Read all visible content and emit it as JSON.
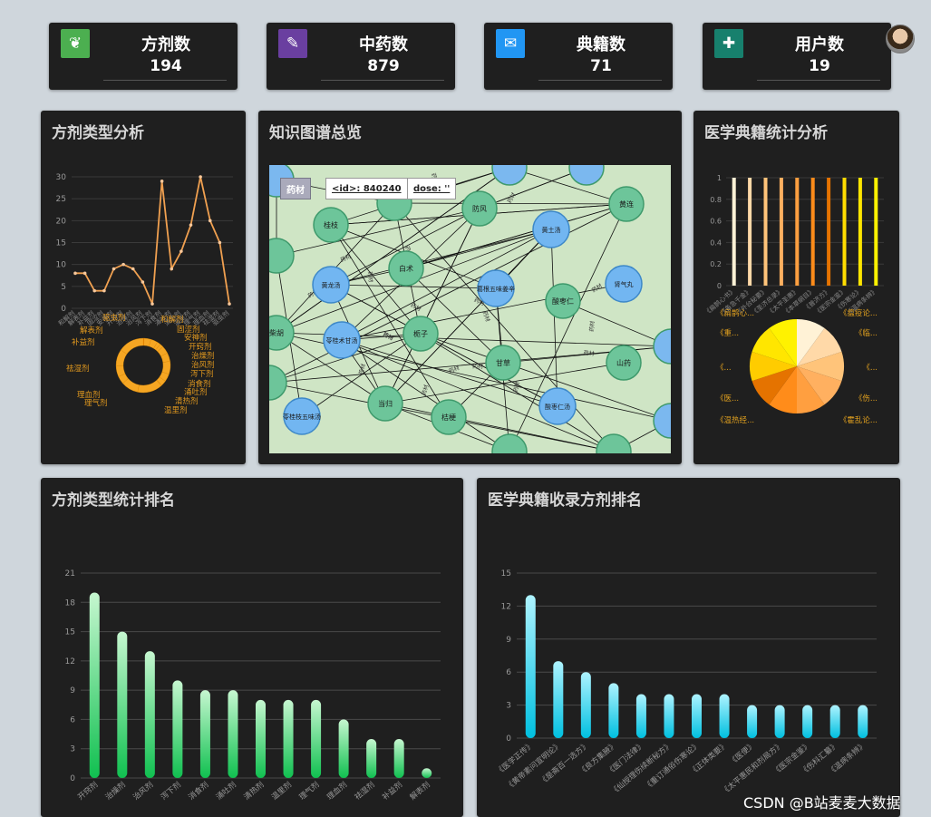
{
  "stats": [
    {
      "label": "方剂数",
      "value": "194",
      "color": "#4caf50",
      "icon": "leaf-icon",
      "glyph": "❦"
    },
    {
      "label": "中药数",
      "value": "879",
      "color": "#6a3fa0",
      "icon": "edit-icon",
      "glyph": "✎"
    },
    {
      "label": "典籍数",
      "value": "71",
      "color": "#2196f3",
      "icon": "chat-icon",
      "glyph": "✉"
    },
    {
      "label": "用户数",
      "value": "19",
      "color": "#17806d",
      "icon": "users-icon",
      "glyph": "✚"
    }
  ],
  "panels": {
    "type_analysis": "方剂类型分析",
    "kg_overview": "知识图谱总览",
    "classic_stats": "医学典籍统计分析",
    "type_rank": "方剂类型统计排名",
    "classic_rank": "医学典籍收录方剂排名"
  },
  "kg": {
    "tip_type": "药材",
    "tip_id": "<id>: 840240",
    "tip_dose": "dose: ''",
    "herb_nodes": [
      "桂枝",
      "白术",
      "栀子",
      "防风",
      "黄连",
      "酸枣仁",
      "当归",
      "柴胡",
      "山药",
      "甘草",
      "桔梗"
    ],
    "formula_nodes": [
      "黄龙汤",
      "苓桂术甘汤",
      "黄土汤",
      "肾气丸",
      "葛根五味姜辛",
      "酸枣仁汤",
      "苓桂枝五味汤"
    ],
    "edge_label": "药材"
  },
  "watermark": "CSDN @B站麦麦大数据",
  "chart_data": [
    {
      "type": "line",
      "title": "方剂类型分析",
      "categories": [
        "和解剂",
        "解表剂",
        "补益剂",
        "固涩剂",
        "安神剂",
        "开窍剂",
        "治燥剂",
        "治风剂",
        "泻下剂",
        "消食剂",
        "涌吐剂",
        "清热剂",
        "温里剂",
        "理气剂",
        "理血剂",
        "祛湿剂",
        "驱虫剂"
      ],
      "values": [
        8,
        8,
        4,
        4,
        9,
        10,
        9,
        6,
        1,
        29,
        9,
        13,
        19,
        30,
        20,
        15,
        1
      ],
      "ylim": [
        0,
        30
      ],
      "yticks": [
        0,
        5,
        10,
        15,
        20,
        25,
        30
      ],
      "color": "#f0a050"
    },
    {
      "type": "pie",
      "title": "方剂类型分析 (环形)",
      "labels": [
        "驱虫剂",
        "和解剂",
        "解表剂",
        "固涩剂",
        "补益剂",
        "安神剂",
        "开窍剂",
        "祛湿剂",
        "治燥剂",
        "治风剂",
        "泻下剂",
        "消食剂",
        "理血剂",
        "涌吐剂",
        "理气剂",
        "清热剂",
        "温里剂"
      ],
      "values": [
        1,
        8,
        8,
        4,
        4,
        9,
        10,
        15,
        9,
        6,
        1,
        29,
        20,
        9,
        13,
        19,
        30
      ],
      "color": "#f5a623"
    },
    {
      "type": "bar",
      "title": "医学典籍统计分析",
      "categories": [
        "《扁鹊心书》",
        "《备急千金》",
        "《外台秘要》",
        "《圣济总录》",
        "《太平圣惠》",
        "《本草纲目》",
        "《普济方》",
        "《医宗金鉴》",
        "《伤寒论》",
        "《温病条辨》"
      ],
      "values": [
        1,
        1,
        1,
        1,
        1,
        1,
        1,
        1,
        1,
        1
      ],
      "ylim": [
        0,
        1
      ],
      "yticks": [
        0,
        0.2,
        0.4,
        0.6,
        0.8,
        1
      ],
      "colors": [
        "#fff2d6",
        "#ffd9a8",
        "#ffc47a",
        "#ffb060",
        "#ff9f40",
        "#ff8c1a",
        "#e57300",
        "#ffdd00",
        "#ffe600",
        "#fff200"
      ]
    },
    {
      "type": "pie",
      "title": "医学典籍饼图",
      "labels": [
        "《扁鹊心...",
        "《重...",
        "《...",
        "《医...",
        "《温热经...",
        "《瘟疫论...",
        "《临...",
        "《...",
        "《伤...",
        "《霍乱论..."
      ],
      "values": [
        1,
        1,
        1,
        1,
        1,
        1,
        1,
        1,
        1,
        1
      ],
      "colors": [
        "#fff2d6",
        "#ffd9a8",
        "#ffc47a",
        "#ffb060",
        "#ff9f40",
        "#ff8c1a",
        "#e57300",
        "#ffcc00",
        "#ffe600",
        "#fff200"
      ]
    },
    {
      "type": "bar",
      "title": "方剂类型统计排名",
      "categories": [
        "开窍剂",
        "治燥剂",
        "治风剂",
        "泻下剂",
        "消食剂",
        "涌吐剂",
        "清热剂",
        "温里剂",
        "理气剂",
        "理血剂",
        "祛湿剂",
        "补益剂",
        "解表剂"
      ],
      "values": [
        19,
        15,
        13,
        10,
        9,
        9,
        8,
        8,
        8,
        6,
        4,
        4,
        1
      ],
      "ylim": [
        0,
        21
      ],
      "yticks": [
        0,
        3,
        6,
        9,
        12,
        15,
        18,
        21
      ],
      "color_top": "#c6f7d0",
      "color_bottom": "#10c050"
    },
    {
      "type": "bar",
      "title": "医学典籍收录方剂排名",
      "categories": [
        "《医学正传》",
        "《黄帝素问宣明论》",
        "《是斋百一选方》",
        "《良方集腋》",
        "《医门法律》",
        "《仙授理伤续断秘方》",
        "《重订通俗伤寒论》",
        "《正体类要》",
        "《医便》",
        "《太平惠民和剂局方》",
        "《医宗金鉴》",
        "《伤科汇纂》",
        "《温病条辨》"
      ],
      "values": [
        13,
        7,
        6,
        5,
        4,
        4,
        4,
        4,
        3,
        3,
        3,
        3,
        3
      ],
      "ylim": [
        0,
        15
      ],
      "yticks": [
        0,
        3,
        6,
        9,
        12,
        15
      ],
      "color_top": "#aef3ff",
      "color_bottom": "#00c0e0"
    }
  ]
}
